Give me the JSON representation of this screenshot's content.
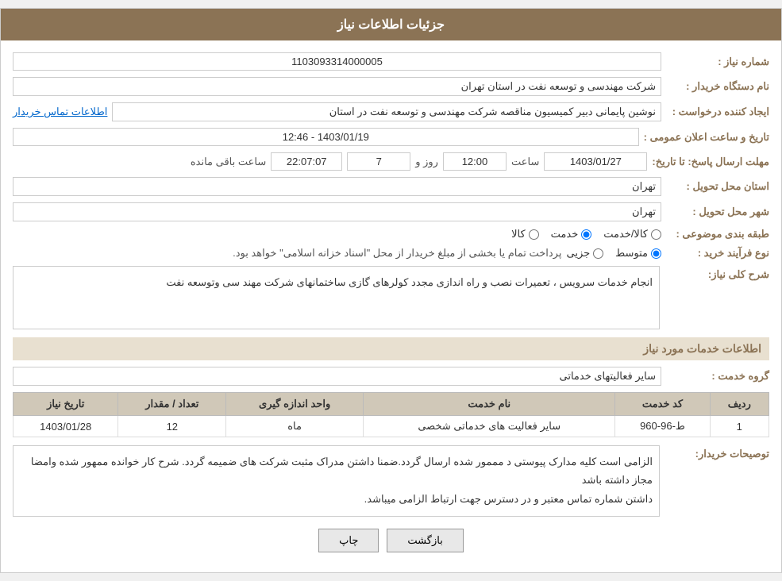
{
  "header": {
    "title": "جزئیات اطلاعات نیاز"
  },
  "fields": {
    "need_number_label": "شماره نیاز :",
    "need_number_value": "1103093314000005",
    "buyer_label": "نام دستگاه خریدار :",
    "buyer_value": "شرکت مهندسی و توسعه نفت در استان تهران",
    "creator_label": "ایجاد کننده درخواست :",
    "creator_value": "نوشین پایمانی دبیر کمیسیون مناقصه شرکت مهندسی و توسعه نفت در استان",
    "contact_link": "اطلاعات تماس خریدار",
    "announce_label": "تاریخ و ساعت اعلان عمومی :",
    "announce_value": "1403/01/19 - 12:46",
    "response_deadline_label": "مهلت ارسال پاسخ: تا تاریخ:",
    "response_date": "1403/01/27",
    "response_time_label": "ساعت",
    "response_time": "12:00",
    "response_day_label": "روز و",
    "response_days": "7",
    "remaining_label": "ساعت باقی مانده",
    "remaining_value": "22:07:07",
    "province_label": "استان محل تحویل :",
    "province_value": "تهران",
    "city_label": "شهر محل تحویل :",
    "city_value": "تهران",
    "category_label": "طبقه بندی موضوعی :",
    "category_options": [
      {
        "label": "کالا",
        "value": "kala"
      },
      {
        "label": "خدمت",
        "value": "khadamat"
      },
      {
        "label": "کالا/خدمت",
        "value": "kala_khadamat"
      }
    ],
    "category_selected": "khadamat",
    "process_label": "نوع فرآیند خرید :",
    "process_options": [
      {
        "label": "جزیی",
        "value": "jozi"
      },
      {
        "label": "متوسط",
        "value": "motovasset"
      }
    ],
    "process_selected": "motovasset",
    "process_note": "پرداخت تمام یا بخشی از مبلغ خریدار از محل \"اسناد خزانه اسلامی\" خواهد بود.",
    "description_label": "شرح کلی نیاز:",
    "description_value": "انجام خدمات سرویس ، تعمیرات نصب و راه اندازی مجدد کولرهای گازی ساختمانهای شرکت مهند سی وتوسعه نفت"
  },
  "service_section": {
    "title": "اطلاعات خدمات مورد نیاز",
    "group_label": "گروه خدمت :",
    "group_value": "سایر فعالیتهای خدماتی"
  },
  "table": {
    "columns": [
      "ردیف",
      "کد خدمت",
      "نام خدمت",
      "واحد اندازه گیری",
      "تعداد / مقدار",
      "تاریخ نیاز"
    ],
    "rows": [
      {
        "row": "1",
        "code": "ط-96-960",
        "name": "سایر فعالیت های خدماتی شخصی",
        "unit": "ماه",
        "quantity": "12",
        "date": "1403/01/28"
      }
    ]
  },
  "buyer_notes_label": "توصیحات خریدار:",
  "buyer_notes": "الزامی است کلیه مدارک پیوستی د مممور شده ارسال گردد.ضمنا داشتن مدراک مثبت شرکت های ضمیمه گردد. شرح کار خوانده ممهور شده وامضا مجاز داشته باشد\nداشتن شماره تماس معتبر و در دسترس جهت ارتباط الزامی میباشد.",
  "buttons": {
    "print": "چاپ",
    "back": "بازگشت"
  }
}
